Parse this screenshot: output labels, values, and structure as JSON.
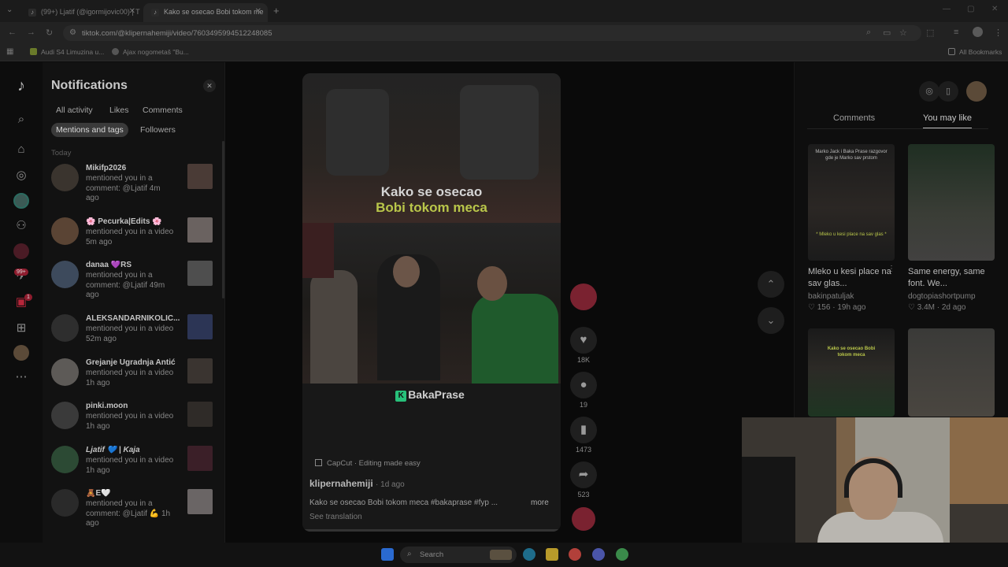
{
  "browser": {
    "tabs": [
      {
        "title": "(99+) Ljatif (@igormijovic00) | T"
      },
      {
        "title": "Kako se osecao Bobi tokom me"
      }
    ],
    "url": "tiktok.com/@klipernahemiji/video/7603495994512248085",
    "bookmarks": [
      {
        "label": "Audi S4 Limuzina u..."
      },
      {
        "label": "Ajax nogometaš \"Bu..."
      }
    ],
    "all_bookmarks": "All Bookmarks"
  },
  "notifications": {
    "title": "Notifications",
    "tabs": [
      "All activity",
      "Likes",
      "Comments",
      "Mentions and tags",
      "Followers"
    ],
    "active_tab": "Mentions and tags",
    "section": "Today",
    "items": [
      {
        "name": "Mikifp2026",
        "text": "mentioned you in a comment: @Ljatif 4m ago"
      },
      {
        "name": "🌸 Pecurka|Edits 🌸",
        "text": "mentioned you in a video 5m ago"
      },
      {
        "name": "danaa 💜RS",
        "text": "mentioned you in a comment: @Ljatif 49m ago"
      },
      {
        "name": "ALEKSANDARNIKOLIC...",
        "text": "mentioned you in a video 52m ago"
      },
      {
        "name": "Grejanje Ugradnja Antić",
        "text": "mentioned you in a video 1h ago"
      },
      {
        "name": "pinki.moon",
        "text": "mentioned you in a video 1h ago"
      },
      {
        "name": "Ljatif 💙 | Kaja",
        "text": "mentioned you in a video 1h ago"
      },
      {
        "name": "🧸E🤍",
        "text": "mentioned you in a comment: @Ljatif 💪 1h ago"
      }
    ]
  },
  "leftnav": {
    "badge_messages": "99+",
    "badge_inbox": "1"
  },
  "video": {
    "caption_line1": "Kako se osecao",
    "caption_line2": "Bobi tokom meca",
    "watermark": "BakaPrase",
    "capcut": "CapCut · Editing made easy",
    "author": "klipernahemiji",
    "posted": "· 1d ago",
    "description": "Kako se osecao Bobi tokom meca #bakaprase #fyp ...",
    "more": "more",
    "see_translation": "See translation",
    "likes": "18K",
    "comments": "19",
    "saves": "1473",
    "shares": "523"
  },
  "right_panel": {
    "tabs": [
      "Comments",
      "You may like"
    ],
    "active_tab": "You may like",
    "cards": [
      {
        "title": "Mleko u kesi place na sav glas...",
        "user": "bakinpatuljak",
        "likes": "156",
        "age": "19h ago",
        "overlay": "Marko Jack i Baka Prase razgovor gde je Marko sav prstom",
        "overlay2": "* Mleko u kesi place na sav glas *"
      },
      {
        "title": "Same energy, same font. We...",
        "user": "dogtopiashortpump",
        "likes": "3.4M",
        "age": "2d ago"
      },
      {
        "overlay": "Kako se osecao Bobi tokom meca"
      },
      {}
    ]
  },
  "taskbar": {
    "search_placeholder": "Search"
  },
  "colors": {
    "caption_yellow": "#b9c64a",
    "caption_white": "#d4d4d4",
    "tiktok_red": "#b7263a",
    "green_logo": "#27c07a"
  }
}
